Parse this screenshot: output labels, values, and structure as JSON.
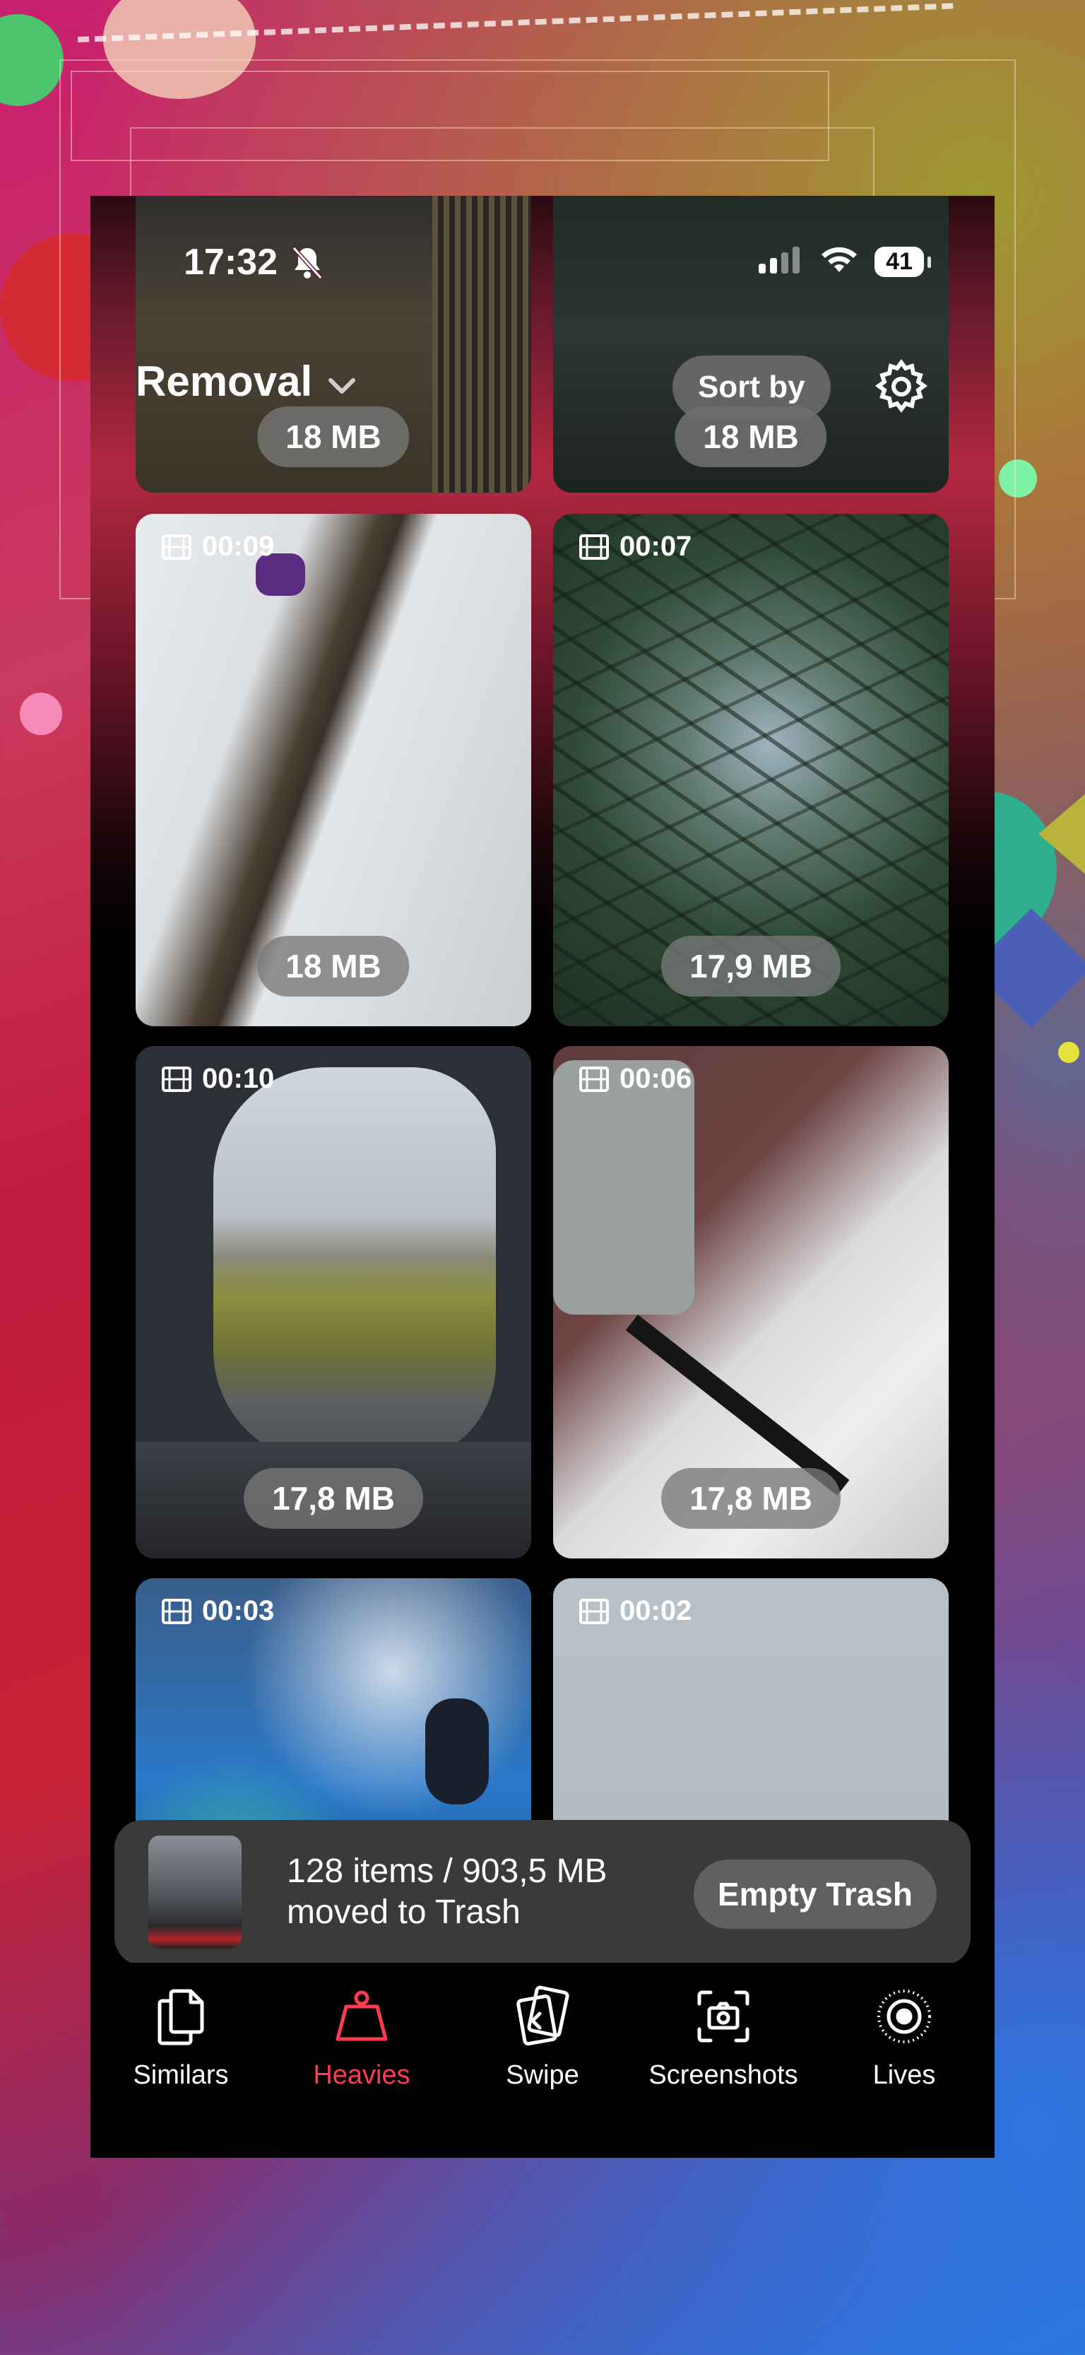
{
  "status_bar": {
    "time": "17:32",
    "battery": "41"
  },
  "header": {
    "title": "Removal",
    "sort_label": "Sort by"
  },
  "grid": [
    {
      "size": "18 MB"
    },
    {
      "size": "18 MB"
    },
    {
      "duration": "00:09",
      "size": "18 MB"
    },
    {
      "duration": "00:07",
      "size": "17,9 MB"
    },
    {
      "duration": "00:10",
      "size": "17,8 MB"
    },
    {
      "duration": "00:06",
      "size": "17,8 MB"
    },
    {
      "duration": "00:03"
    },
    {
      "duration": "00:02"
    }
  ],
  "toast": {
    "line1": "128 items / 903,5 MB",
    "line2": "moved to Trash",
    "button": "Empty Trash"
  },
  "tabs": [
    {
      "label": "Similars",
      "icon": "copy-icon"
    },
    {
      "label": "Heavies",
      "icon": "weight-icon",
      "active": true
    },
    {
      "label": "Swipe",
      "icon": "swipe-cards-icon"
    },
    {
      "label": "Screenshots",
      "icon": "screenshot-camera-icon"
    },
    {
      "label": "Lives",
      "icon": "live-photo-icon"
    }
  ],
  "colors": {
    "accent": "#ff3b54",
    "toast_bg": "#3a3a3a",
    "pill_bg": "#7a7a7a"
  }
}
